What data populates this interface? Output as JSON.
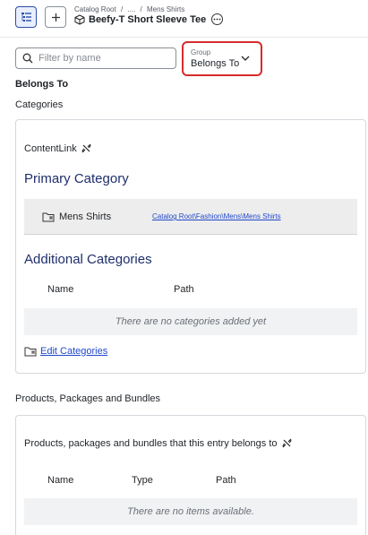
{
  "header": {
    "breadcrumbs": [
      "Catalog Root",
      "/",
      "....",
      "/",
      "Mens Shirts"
    ],
    "title": "Beefy-T Short Sleeve Tee"
  },
  "toolbar": {
    "filter_placeholder": "Filter by name",
    "group_label": "Group",
    "group_value": "Belongs To"
  },
  "section_title": "Belongs To",
  "categories": {
    "heading": "Categories",
    "content_link_label": "ContentLink",
    "primary_heading": "Primary Category",
    "primary": {
      "name": "Mens Shirts",
      "path": "Catalog Root\\Fashion\\Mens\\Mens Shirts"
    },
    "additional_heading": "Additional Categories",
    "columns": [
      "Name",
      "Path"
    ],
    "empty_text": "There are no categories added yet",
    "edit_label": "Edit Categories"
  },
  "products": {
    "heading": "Products, Packages and Bundles",
    "description": "Products, packages and bundles that this entry belongs to",
    "columns": [
      "Name",
      "Type",
      "Path"
    ],
    "empty_text": "There are no items available."
  },
  "colors": {
    "accent": "#2b4fa8",
    "heading_blue": "#1e2f6b",
    "link": "#2148c9",
    "highlight_border": "#d62b2b"
  }
}
